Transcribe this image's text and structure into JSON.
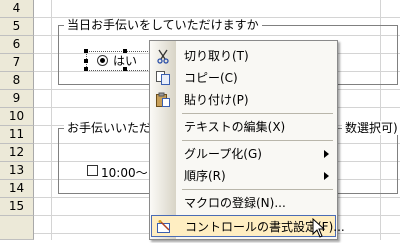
{
  "sheet": {
    "rows": [
      "4",
      "5",
      "6",
      "7",
      "8",
      "9",
      "10",
      "11",
      "12",
      "13",
      "14",
      "15"
    ]
  },
  "group1": {
    "title": "当日お手伝いをしていただけますか"
  },
  "radio": {
    "label": "はい",
    "selected": true
  },
  "group2": {
    "title_left": "お手伝いいただけ",
    "title_right": "数選択可)"
  },
  "checkbox1": {
    "label": "10:00～"
  },
  "menu": {
    "items": [
      {
        "label": "切り取り(T)",
        "icon": "scissors-icon"
      },
      {
        "label": "コピー(C)",
        "icon": "copy-icon"
      },
      {
        "label": "貼り付け(P)",
        "icon": "paste-icon"
      },
      {
        "label": "テキストの編集(X)"
      },
      {
        "label": "グループ化(G)",
        "submenu": true
      },
      {
        "label": "順序(R)",
        "submenu": true
      },
      {
        "label": "マクロの登録(N)..."
      },
      {
        "label": "コントロールの書式設定(F)...",
        "icon": "format-control-icon",
        "highlighted": true
      }
    ]
  },
  "colors": {
    "highlight_bg": "#ffeec2",
    "highlight_border": "#4b6cb5",
    "menu_bg": "#f9f8f4"
  }
}
